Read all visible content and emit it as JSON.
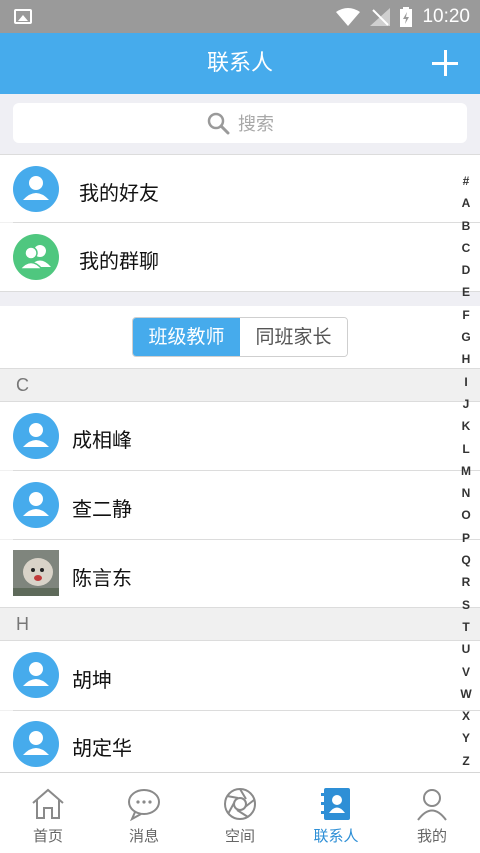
{
  "status_bar": {
    "time": "10:20"
  },
  "header": {
    "title": "联系人"
  },
  "search": {
    "placeholder": "搜索"
  },
  "quick_items": [
    {
      "label": "我的好友",
      "icon": "person-icon",
      "color": "#46abec"
    },
    {
      "label": "我的群聊",
      "icon": "group-icon",
      "color": "#4fc77f"
    }
  ],
  "segment": {
    "options": [
      "班级教师",
      "同班家长"
    ],
    "selected": "班级教师"
  },
  "sections": [
    {
      "letter": "C",
      "contacts": [
        "成相峰",
        "查二静",
        "陈言东"
      ]
    },
    {
      "letter": "H",
      "contacts": [
        "胡坤",
        "胡定华"
      ]
    }
  ],
  "alphabet_index": [
    "#",
    "A",
    "B",
    "C",
    "D",
    "E",
    "F",
    "G",
    "H",
    "I",
    "J",
    "K",
    "L",
    "M",
    "N",
    "O",
    "P",
    "Q",
    "R",
    "S",
    "T",
    "U",
    "V",
    "W",
    "X",
    "Y",
    "Z"
  ],
  "tabs": [
    {
      "label": "首页",
      "icon": "home-icon",
      "active": false
    },
    {
      "label": "消息",
      "icon": "message-icon",
      "active": false
    },
    {
      "label": "空间",
      "icon": "aperture-icon",
      "active": false
    },
    {
      "label": "联系人",
      "icon": "contacts-icon",
      "active": true
    },
    {
      "label": "我的",
      "icon": "profile-icon",
      "active": false
    }
  ],
  "colors": {
    "accent": "#46abec",
    "active_tab": "#2e8fd6",
    "group_green": "#4fc77f"
  }
}
